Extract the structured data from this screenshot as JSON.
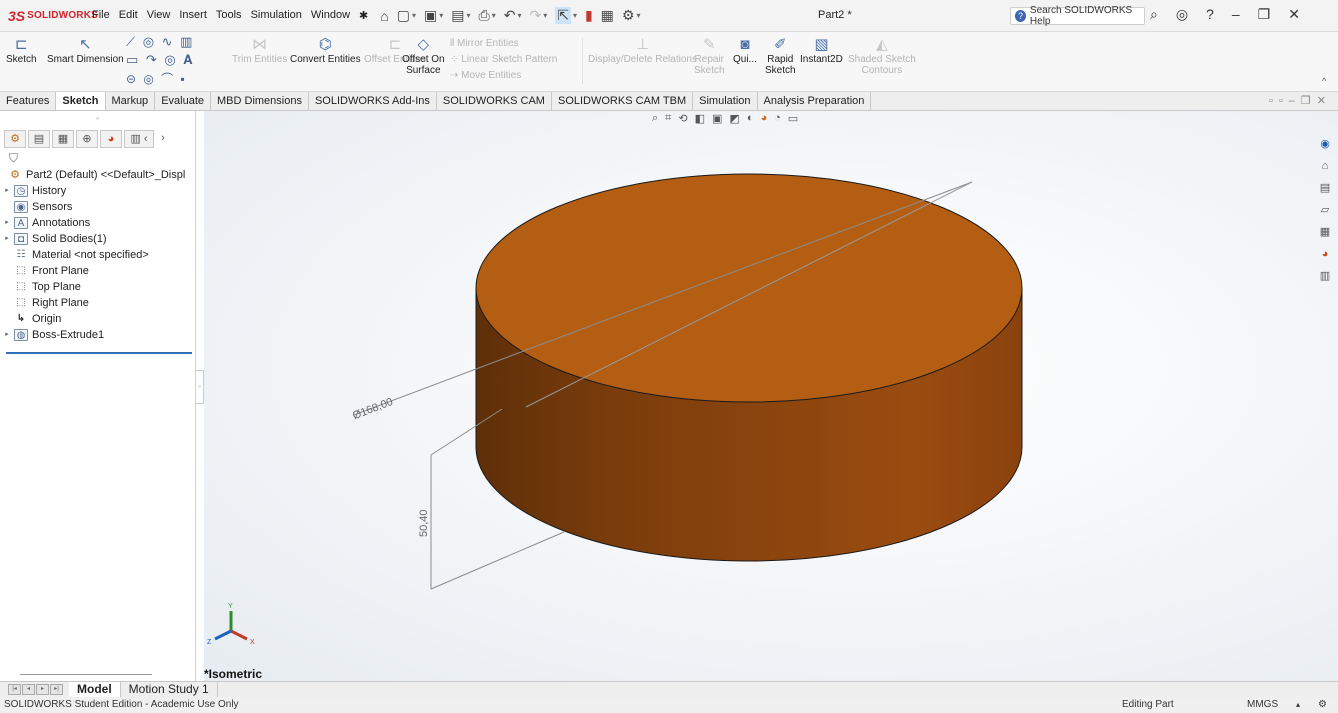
{
  "app": {
    "brand_ds": "3S",
    "brand_name": "SOLIDWORKS",
    "menus": [
      "File",
      "Edit",
      "View",
      "Insert",
      "Tools",
      "Simulation",
      "Window"
    ],
    "document_title": "Part2 *",
    "search_placeholder": "Search SOLIDWORKS Help"
  },
  "ribbon": {
    "sketch": "Sketch",
    "smart_dimension": "Smart Dimension",
    "trim_entities": "Trim Entities",
    "convert_entities": "Convert Entities",
    "offset_entities": "Offset Entities",
    "offset_on": "Offset On",
    "surface": "Surface",
    "mirror_entities": "Mirror Entities",
    "linear_sketch_pattern": "Linear Sketch Pattern",
    "move_entities": "Move Entities",
    "display_delete_relations": "Display/Delete Relations",
    "repair_sketch": "Repair",
    "repair_sketch2": "Sketch",
    "quick_snaps": "Qui...",
    "rapid_sketch": "Rapid",
    "rapid_sketch2": "Sketch",
    "instant2d": "Instant2D",
    "shaded_sketch_contours": "Shaded Sketch",
    "shaded_sketch_contours2": "Contours"
  },
  "tabs": [
    "Features",
    "Sketch",
    "Markup",
    "Evaluate",
    "MBD Dimensions",
    "SOLIDWORKS Add-Ins",
    "SOLIDWORKS CAM",
    "SOLIDWORKS CAM TBM",
    "Simulation",
    "Analysis Preparation"
  ],
  "active_tab": "Sketch",
  "feature_tree": [
    {
      "label": "Part2 (Default) <<Default>_Displ",
      "icon": "part-icon",
      "expand": false
    },
    {
      "label": "History",
      "icon": "history-icon",
      "expand": true
    },
    {
      "label": "Sensors",
      "icon": "sensors-icon",
      "expand": false
    },
    {
      "label": "Annotations",
      "icon": "annotations-icon",
      "expand": true
    },
    {
      "label": "Solid Bodies(1)",
      "icon": "solid-bodies-icon",
      "expand": true
    },
    {
      "label": "Material <not specified>",
      "icon": "material-icon",
      "expand": false
    },
    {
      "label": "Front Plane",
      "icon": "plane-icon",
      "expand": false
    },
    {
      "label": "Top Plane",
      "icon": "plane-icon",
      "expand": false
    },
    {
      "label": "Right Plane",
      "icon": "plane-icon",
      "expand": false
    },
    {
      "label": "Origin",
      "icon": "origin-icon",
      "expand": false
    },
    {
      "label": "Boss-Extrude1",
      "icon": "extrude-icon",
      "expand": true
    }
  ],
  "viewport": {
    "view_name": "*Isometric",
    "diameter_label": "Ø168,00",
    "height_label": "50,40",
    "body_color": "#b35e12",
    "side_color": "#8a420d",
    "triad": {
      "x": "X",
      "y": "Y",
      "z": "Z"
    }
  },
  "bottom_tabs": [
    "Model",
    "Motion Study 1"
  ],
  "status": {
    "left": "SOLIDWORKS Student Edition - Academic Use Only",
    "mode": "Editing Part",
    "units": "MMGS"
  }
}
